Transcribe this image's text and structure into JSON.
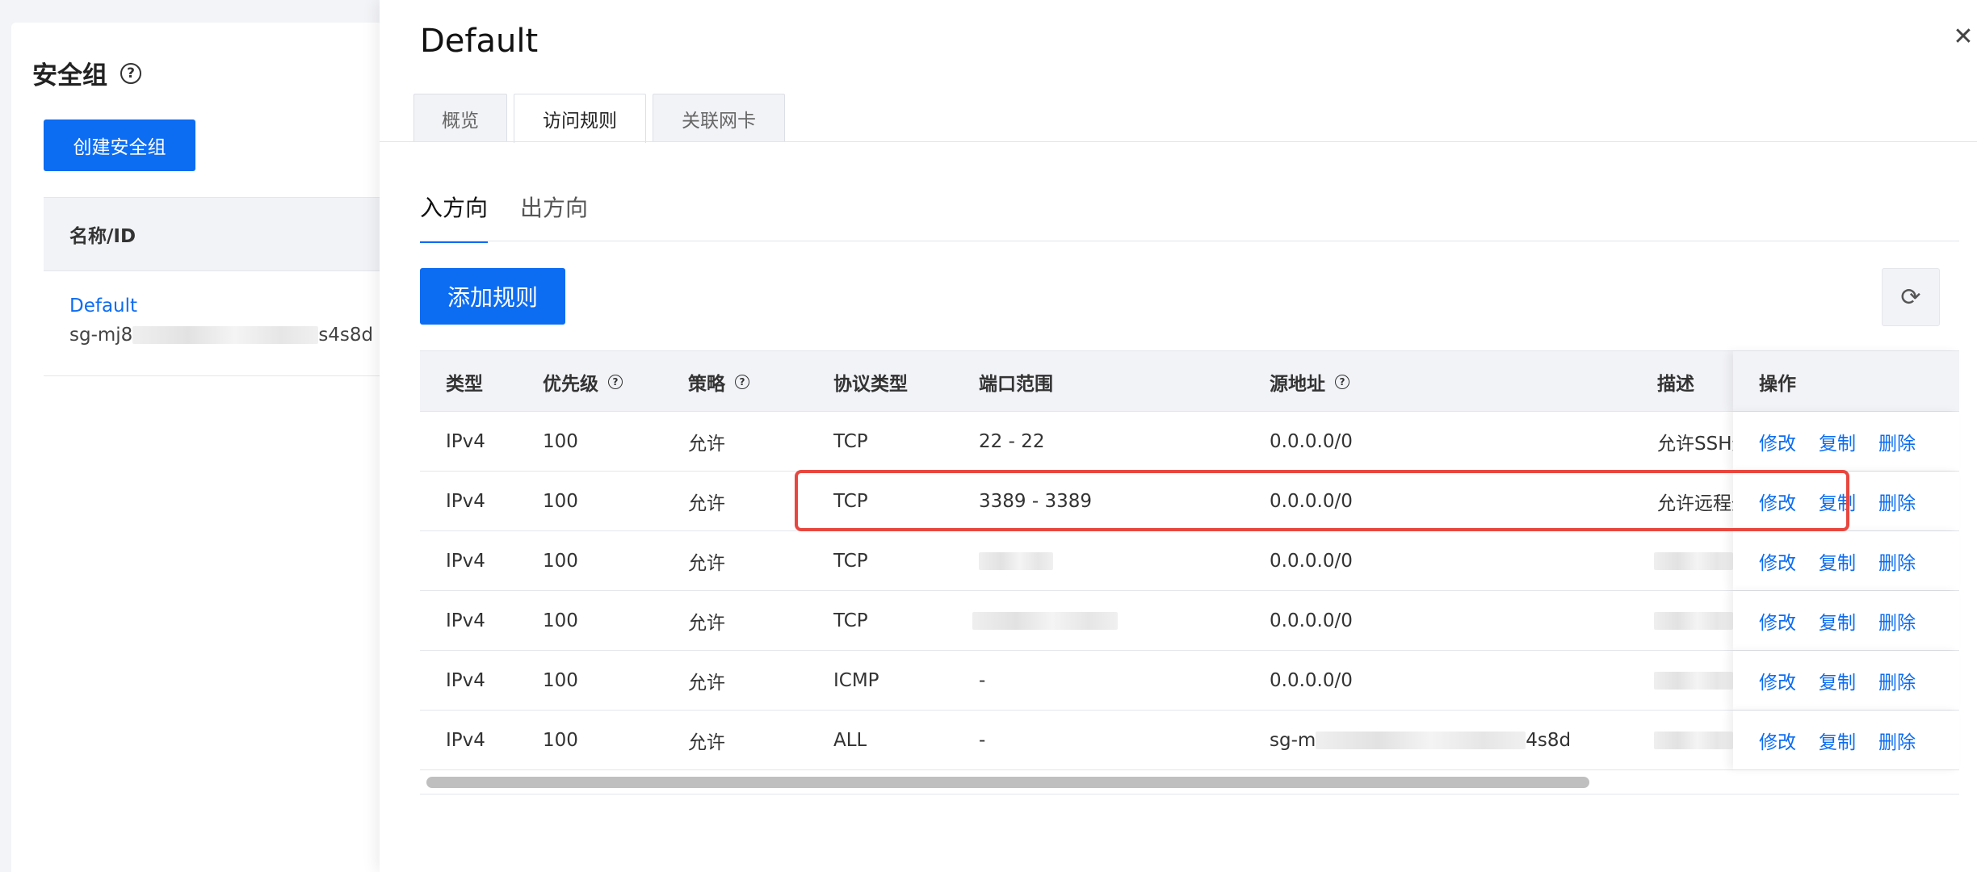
{
  "left": {
    "title": "安全组",
    "create_button": "创建安全组",
    "column_name": "名称/ID",
    "row": {
      "name": "Default",
      "id_prefix": "sg-mj8",
      "id_suffix": "s4s8d"
    }
  },
  "drawer": {
    "title": "Default",
    "tabs": [
      "概览",
      "访问规则",
      "关联网卡"
    ],
    "active_tab": "访问规则",
    "direction_tabs": [
      "入方向",
      "出方向"
    ],
    "active_direction": "入方向",
    "add_button": "添加规则",
    "columns": {
      "type": "类型",
      "priority": "优先级",
      "policy": "策略",
      "protocol": "协议类型",
      "port": "端口范围",
      "source": "源地址",
      "desc": "描述",
      "ops": "操作"
    },
    "actions": {
      "edit": "修改",
      "copy": "复制",
      "delete": "删除"
    },
    "rows": [
      {
        "type": "IPv4",
        "priority": "100",
        "policy": "允许",
        "protocol": "TCP",
        "port": "22 - 22",
        "source": "0.0.0.0/0",
        "desc": "允许SSH远"
      },
      {
        "type": "IPv4",
        "priority": "100",
        "policy": "允许",
        "protocol": "TCP",
        "port": "3389 - 3389",
        "source": "0.0.0.0/0",
        "desc": "允许远程登"
      },
      {
        "type": "IPv4",
        "priority": "100",
        "policy": "允许",
        "protocol": "TCP",
        "port": "",
        "source": "0.0.0.0/0",
        "desc": ""
      },
      {
        "type": "IPv4",
        "priority": "100",
        "policy": "允许",
        "protocol": "TCP",
        "port": "",
        "source": "0.0.0.0/0",
        "desc": ""
      },
      {
        "type": "IPv4",
        "priority": "100",
        "policy": "允许",
        "protocol": "ICMP",
        "port": "-",
        "source": "0.0.0.0/0",
        "desc": ""
      },
      {
        "type": "IPv4",
        "priority": "100",
        "policy": "允许",
        "protocol": "ALL",
        "port": "-",
        "source": "sg-m",
        "source_suffix": "4s8d",
        "desc": ""
      }
    ]
  },
  "colors": {
    "primary": "#0c6cf2",
    "highlight": "#e8473f"
  },
  "icons": {
    "help": "question-circle-icon",
    "close": "close-icon",
    "refresh": "refresh-icon"
  }
}
